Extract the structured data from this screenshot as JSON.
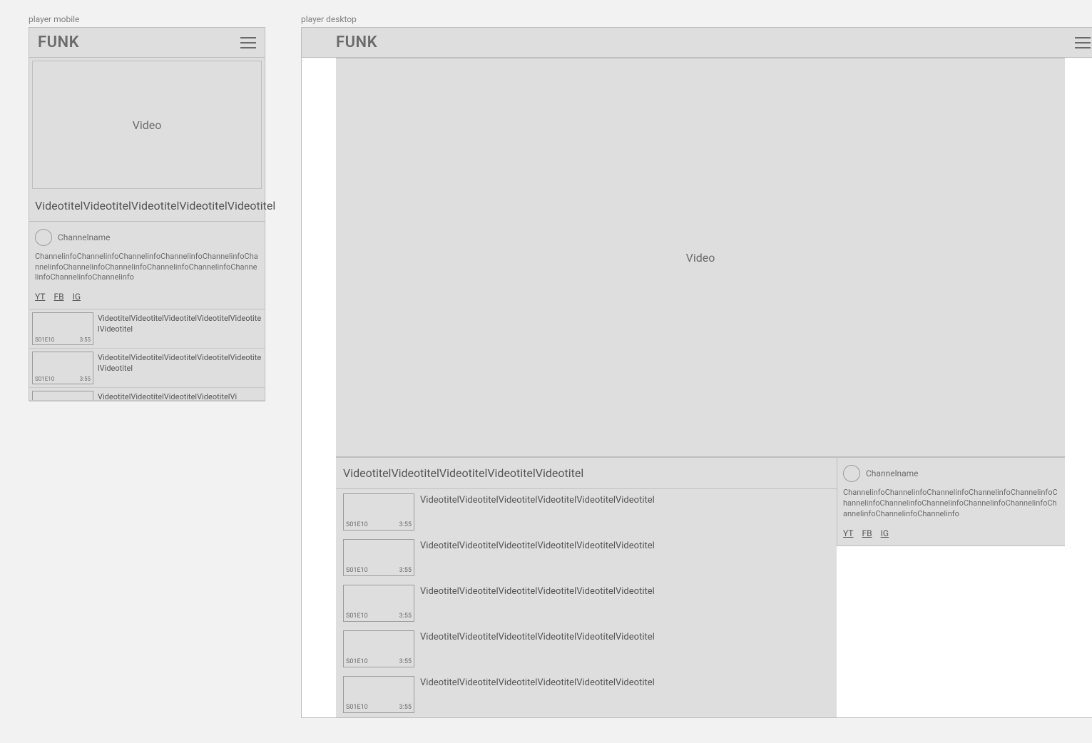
{
  "labels": {
    "mobile": "player mobile",
    "desktop": "player desktop"
  },
  "brand": "FUNK",
  "video_placeholder": "Video",
  "video_title_m": "VideotitelVideotitelVideotitelVideotitelVideotitel",
  "video_title_d": "VideotitelVideotitelVideotitelVideotitelVideotitel",
  "channel": {
    "name": "Channelname",
    "info": "ChannelinfoChannelinfoChannelinfoChannelinfoChannelinfoChannelinfoChannelinfoChannelinfoChannelinfoChannelinfoChannelinfoChannelinfoChannelinfo"
  },
  "socials": {
    "yt": "YT",
    "fb": "FB",
    "ig": "IG"
  },
  "mobile_playlist": [
    {
      "ep": "S01E10",
      "dur": "3:55",
      "title": "VideotitelVideotitelVideotitelVideotitelVideotitelVideotitel"
    },
    {
      "ep": "S01E10",
      "dur": "3:55",
      "title": "VideotitelVideotitelVideotitelVideotitelVideotitelVideotitel"
    },
    {
      "ep": "",
      "dur": "",
      "title": "VideotitelVideotitelVideotitelVideotitelVi"
    }
  ],
  "desktop_playlist": [
    {
      "ep": "S01E10",
      "dur": "3:55",
      "title": "VideotitelVideotitelVideotitelVideotitelVideotitelVideotitel"
    },
    {
      "ep": "S01E10",
      "dur": "3:55",
      "title": "VideotitelVideotitelVideotitelVideotitelVideotitelVideotitel"
    },
    {
      "ep": "S01E10",
      "dur": "3:55",
      "title": "VideotitelVideotitelVideotitelVideotitelVideotitelVideotitel"
    },
    {
      "ep": "S01E10",
      "dur": "3:55",
      "title": "VideotitelVideotitelVideotitelVideotitelVideotitelVideotitel"
    },
    {
      "ep": "S01E10",
      "dur": "3:55",
      "title": "VideotitelVideotitelVideotitelVideotitelVideotitelVideotitel"
    }
  ]
}
